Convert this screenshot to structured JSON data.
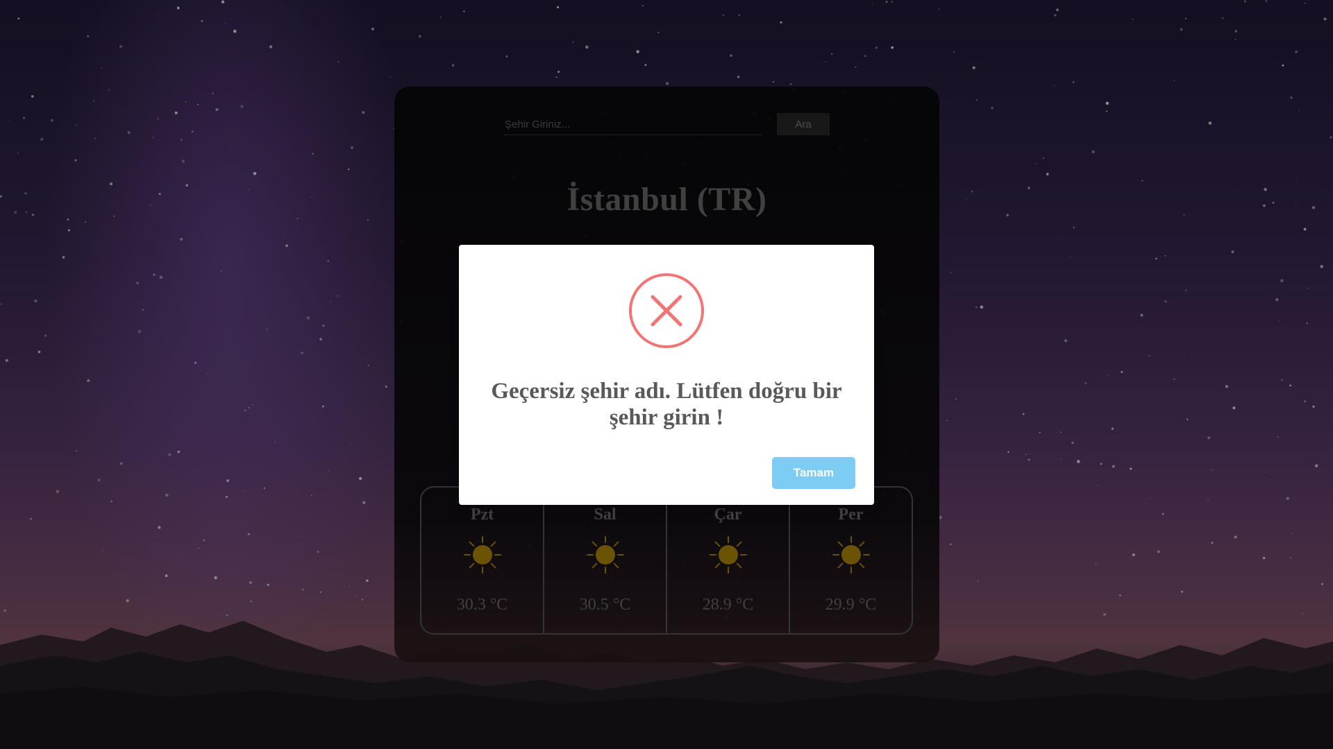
{
  "search": {
    "placeholder": "Şehir Giriniz...",
    "button_label": "Ara"
  },
  "city": {
    "title": "İstanbul (TR)"
  },
  "forecast": [
    {
      "day": "Pzt",
      "icon": "sun-icon",
      "temp": "30.3 °C"
    },
    {
      "day": "Sal",
      "icon": "sun-icon",
      "temp": "30.5 °C"
    },
    {
      "day": "Çar",
      "icon": "sun-icon",
      "temp": "28.9 °C"
    },
    {
      "day": "Per",
      "icon": "sun-icon",
      "temp": "29.9 °C"
    }
  ],
  "modal": {
    "icon": "error-icon",
    "message": "Geçersiz şehir adı. Lütfen doğru bir şehir girin !",
    "confirm_label": "Tamam"
  },
  "colors": {
    "error_red": "#f27474",
    "confirm_blue": "#7cccf4",
    "sun_gold": "#b8900c"
  }
}
